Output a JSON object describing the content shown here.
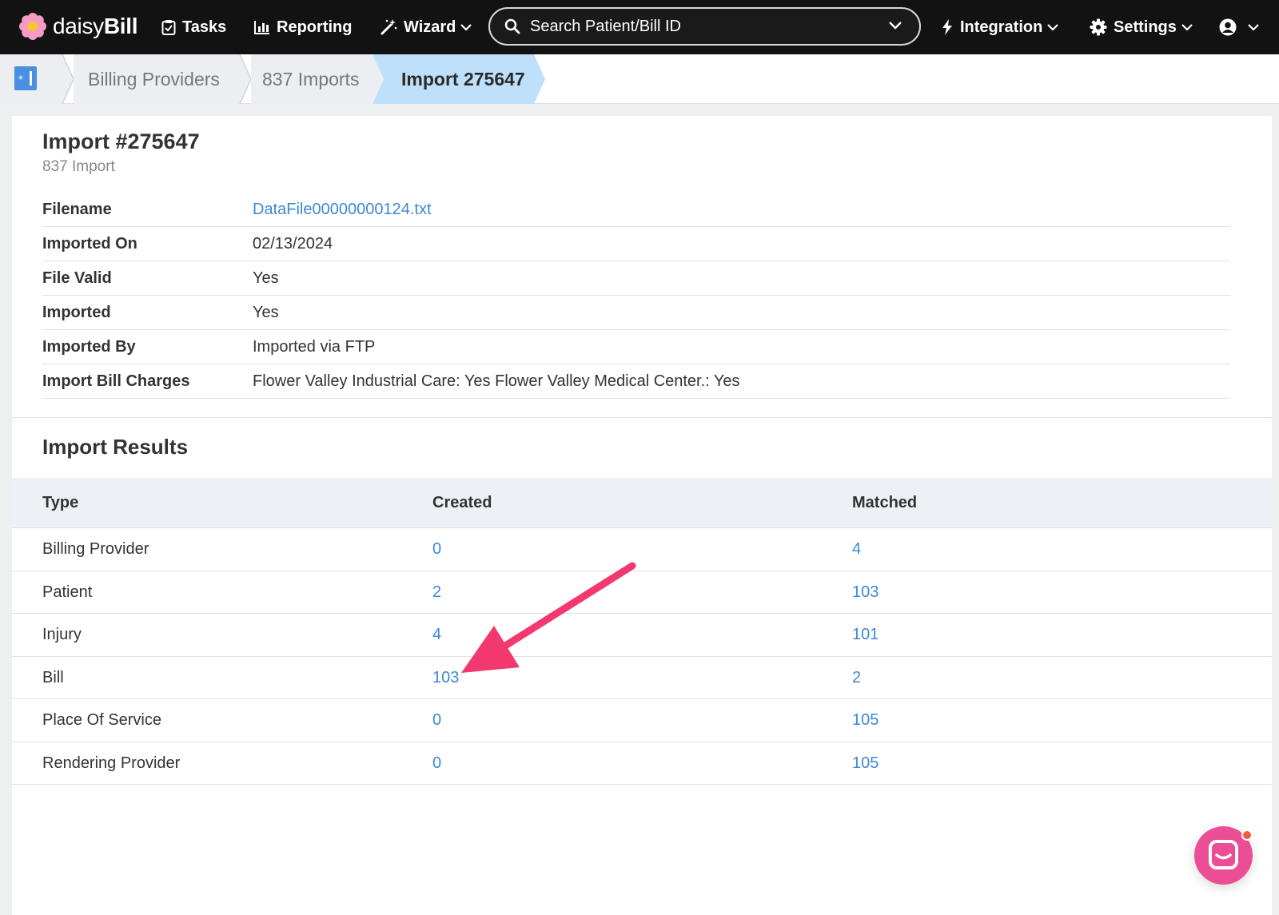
{
  "app": {
    "logo_prefix": "daisy",
    "logo_bold": "Bill"
  },
  "nav": {
    "tasks": "Tasks",
    "reporting": "Reporting",
    "wizard": "Wizard",
    "search_placeholder": "Search Patient/Bill ID",
    "integration": "Integration",
    "settings": "Settings"
  },
  "breadcrumb": {
    "items": [
      "Billing Providers",
      "837 Imports",
      "Import 275647"
    ]
  },
  "import": {
    "title": "Import #275647",
    "subtitle": "837 Import",
    "fields": [
      {
        "label": "Filename",
        "value": "DataFile00000000124.txt"
      },
      {
        "label": "Imported On",
        "value": "02/13/2024"
      },
      {
        "label": "File Valid",
        "value": "Yes"
      },
      {
        "label": "Imported",
        "value": "Yes"
      },
      {
        "label": "Imported By",
        "value": "Imported via FTP"
      },
      {
        "label": "Import Bill Charges",
        "value": "Flower Valley Industrial Care: Yes Flower Valley Medical Center.: Yes"
      }
    ]
  },
  "results": {
    "title": "Import Results",
    "columns": [
      "Type",
      "Created",
      "Matched"
    ],
    "rows": [
      {
        "type": "Billing Provider",
        "created": "0",
        "matched": "4"
      },
      {
        "type": "Patient",
        "created": "2",
        "matched": "103"
      },
      {
        "type": "Injury",
        "created": "4",
        "matched": "101"
      },
      {
        "type": "Bill",
        "created": "103",
        "matched": "2"
      },
      {
        "type": "Place Of Service",
        "created": "0",
        "matched": "105"
      },
      {
        "type": "Rendering Provider",
        "created": "0",
        "matched": "105"
      }
    ]
  },
  "colors": {
    "nav_bg": "#121212",
    "link": "#3e88d6",
    "active_crumb": "#bfe0fb",
    "annotation_arrow": "#f2386f",
    "chat": "#ec4e96"
  }
}
